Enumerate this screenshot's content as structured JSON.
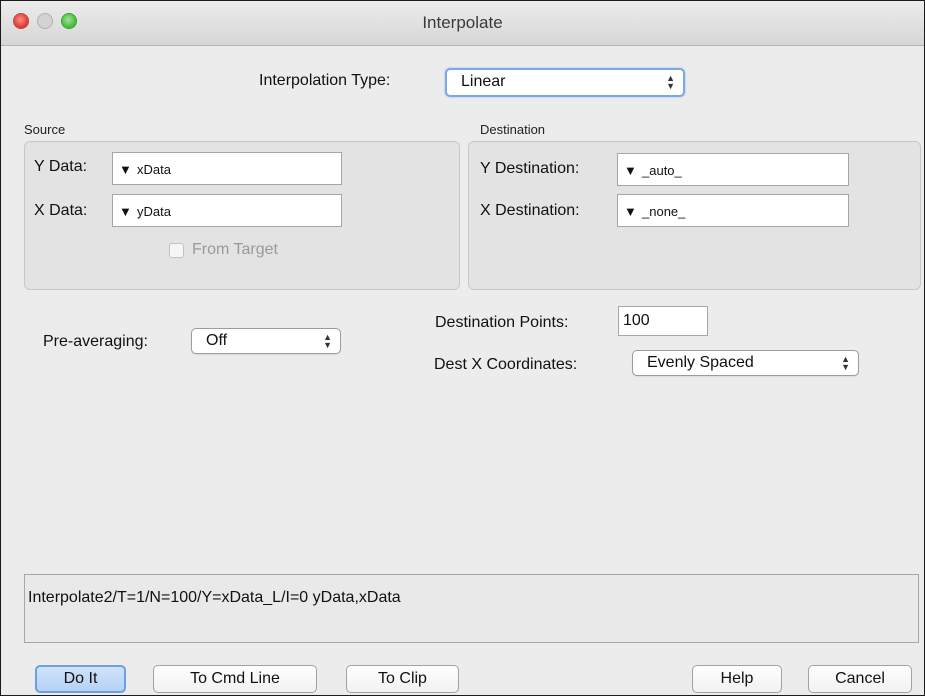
{
  "window": {
    "title": "Interpolate"
  },
  "interpolation": {
    "label": "Interpolation Type:",
    "value": "Linear"
  },
  "source": {
    "heading": "Source",
    "y_label": "Y Data:",
    "y_value": "xData",
    "x_label": "X Data:",
    "x_value": "yData",
    "from_target_label": "From Target",
    "from_target_checked": false
  },
  "destination": {
    "heading": "Destination",
    "y_label": "Y Destination:",
    "y_value": "_auto_",
    "x_label": "X Destination:",
    "x_value": "_none_"
  },
  "pre_averaging": {
    "label": "Pre-averaging:",
    "value": "Off"
  },
  "dest_points": {
    "label": "Destination Points:",
    "value": "100"
  },
  "dest_x_coords": {
    "label": "Dest X Coordinates:",
    "value": "Evenly Spaced"
  },
  "command": {
    "text": "Interpolate2/T=1/N=100/Y=xData_L/I=0 yData,xData"
  },
  "buttons": {
    "do_it": "Do It",
    "to_cmd_line": "To Cmd Line",
    "to_clip": "To Clip",
    "help": "Help",
    "cancel": "Cancel"
  },
  "icons": {
    "popup_arrows": "updown-chevron-icon",
    "dropdown": "triangle-down-icon"
  }
}
